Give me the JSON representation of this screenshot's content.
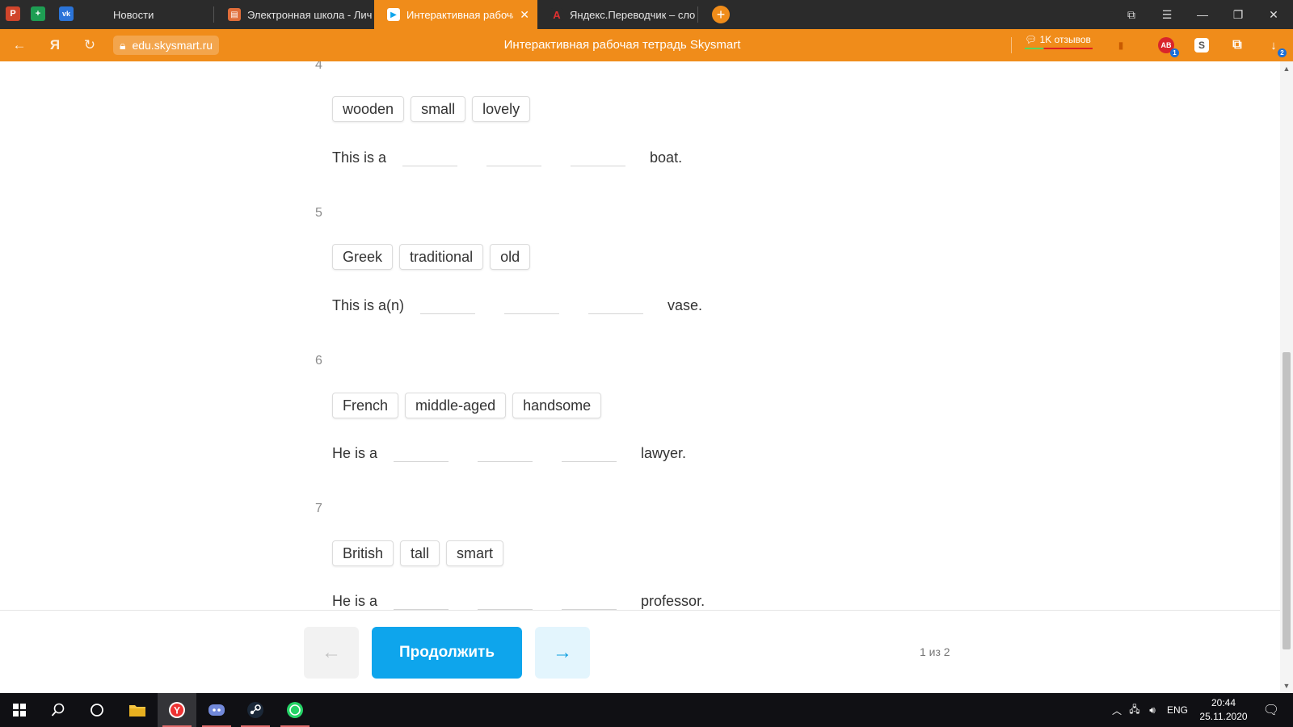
{
  "browser": {
    "pinned": [
      {
        "name": "powerpoint",
        "letter": "P",
        "color": "#d0452b"
      },
      {
        "name": "sheets",
        "letter": "+",
        "color": "#1e9e53"
      },
      {
        "name": "vk",
        "letter": "vk",
        "color": "#2b74d8"
      }
    ],
    "tabs": [
      {
        "title": "Новости",
        "active": false
      },
      {
        "title": "Электронная школа - Лич",
        "active": false
      },
      {
        "title": "Интерактивная рабоча",
        "active": true
      },
      {
        "title": "Яндекс.Переводчик – сло",
        "active": false
      }
    ],
    "url": "edu.skysmart.ru",
    "page_title": "Интерактивная рабочая тетрадь Skysmart",
    "reviews_label": "1K отзывов",
    "download_badge": "2",
    "ext_badge": "1",
    "ext_s_letter": "S",
    "accent": "#f08c1a"
  },
  "tasks": [
    {
      "number": "4",
      "options": [
        "wooden",
        "small",
        "lovely"
      ],
      "before": "This is a",
      "after": "boat."
    },
    {
      "number": "5",
      "options": [
        "Greek",
        "traditional",
        "old"
      ],
      "before": "This is a(n)",
      "after": "vase."
    },
    {
      "number": "6",
      "options": [
        "French",
        "middle-aged",
        "handsome"
      ],
      "before": "He is a",
      "after": "lawyer."
    },
    {
      "number": "7",
      "options": [
        "British",
        "tall",
        "smart"
      ],
      "before": "He is a",
      "after": "professor."
    }
  ],
  "nav": {
    "prev_icon": "←",
    "continue_label": "Продолжить",
    "next_icon": "→",
    "page_indicator": "1 из 2",
    "primary_color": "#0ea5ec"
  },
  "taskbar": {
    "lang": "ENG",
    "time": "20:44",
    "date": "25.11.2020"
  }
}
